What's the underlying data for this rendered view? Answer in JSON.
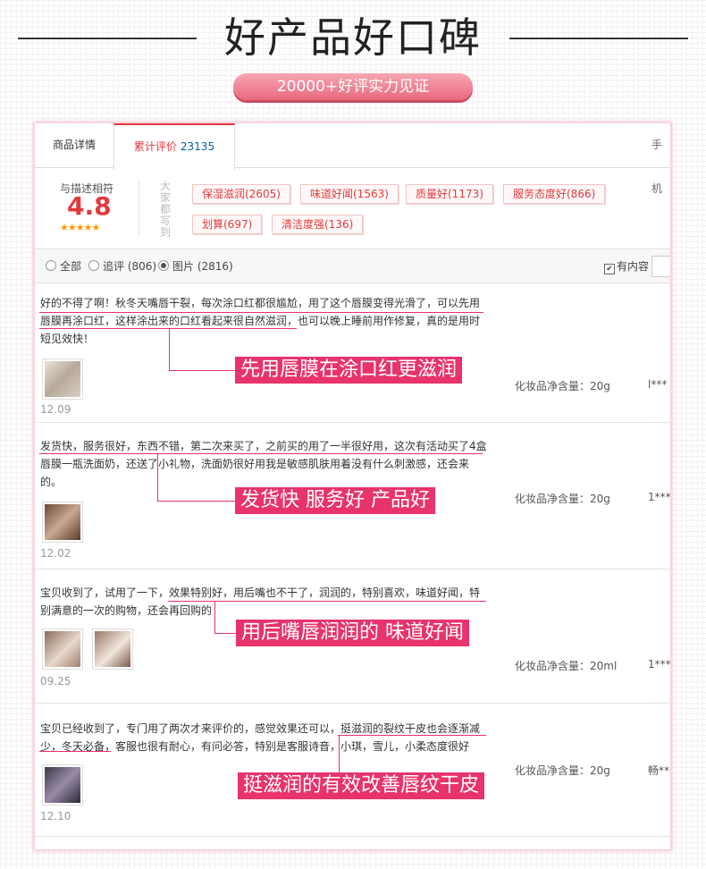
{
  "header": {
    "title": "好产品好口碑",
    "subtitle": "20000+好评实力见证"
  },
  "tabs": {
    "details": "商品详情",
    "reviews": "累计评价",
    "reviews_count": "23135",
    "mobile": "手机"
  },
  "summary": {
    "match_label": "与描述相符",
    "score": "4.8",
    "stars": "★★★★★",
    "tags_heading": "大家都写到",
    "tags": [
      "保湿滋润(2605)",
      "味道好闻(1563)",
      "质量好(1173)",
      "服务态度好(866)",
      "划算(697)",
      "清洁度强(136)"
    ]
  },
  "filter": {
    "all": "全部",
    "followup": "追评 (806)",
    "pictures": "图片 (2816)",
    "has_content": "有内容"
  },
  "reviews": [
    {
      "text": "好的不得了啊！秋冬天嘴唇干裂，每次涂口红都很尴尬，用了这个唇膜变得光滑了，可以先用唇膜再涂口红，这样涂出来的口红看起来很自然滋润，也可以晚上睡前用作修复，真的是用时短见效快！",
      "date": "12.09",
      "spec": "化妆品净含量：20g",
      "user": "l***",
      "callout": "先用唇膜在涂口红更滋润"
    },
    {
      "text": "发货快，服务很好，东西不错，第二次来买了，之前买的用了一半很好用，这次有活动买了4盒唇膜一瓶洗面奶，还送了小礼物，洗面奶很好用我是敏感肌肤用着没有什么刺激感，还会来的。",
      "date": "12.02",
      "spec": "化妆品净含量：20g",
      "user": "1***",
      "callout": "发货快 服务好 产品好"
    },
    {
      "text": "宝贝收到了，试用了一下，效果特别好，用后嘴也不干了，润润的，特别喜欢，味道好闻，特别满意的一次的购物，还会再回购的",
      "date": "09.25",
      "spec": "化妆品净含量：20ml",
      "user": "1***",
      "callout": "用后嘴唇润润的 味道好闻"
    },
    {
      "text": "宝贝已经收到了，专门用了两次才来评价的，感觉效果还可以，挺滋润的裂纹干皮也会逐渐减少，冬天必备，客服也很有耐心，有问必答，特别是客服诗音，小琪，雪儿，小柔态度很好",
      "date": "12.10",
      "spec": "化妆品净含量：20g",
      "user": "畅**",
      "callout": "挺滋润的有效改善唇纹干皮"
    }
  ],
  "colors": {
    "accent": "#e8336c",
    "tab_red": "#e4393c",
    "score_orange": "#e4393c",
    "star": "#ff9900"
  }
}
